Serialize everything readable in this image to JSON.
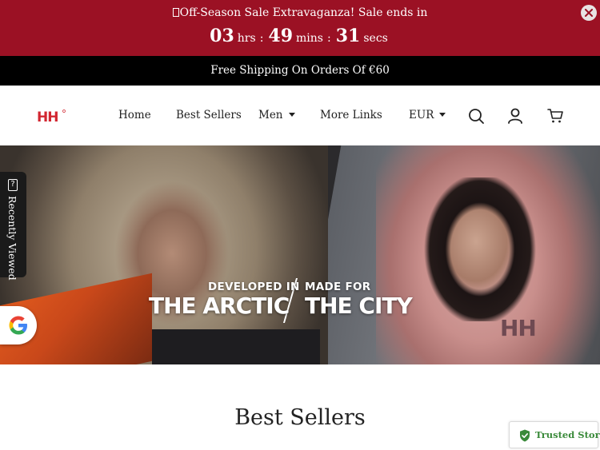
{
  "promo": {
    "message": "Off-Season Sale Extravaganza! Sale ends in",
    "countdown": {
      "hours": "03",
      "hours_unit": "hrs",
      "minutes": "49",
      "minutes_unit": "mins",
      "seconds": "31",
      "seconds_unit": "secs",
      "separator": ":"
    },
    "close_icon": "close-icon",
    "background_color": "#9b1124"
  },
  "shipping": {
    "text": "Free Shipping On Orders Of €60"
  },
  "header": {
    "logo_text": "HH",
    "nav": {
      "home": "Home",
      "best_sellers": "Best Sellers",
      "men": "Men",
      "more_links": "More Links"
    },
    "currency": "EUR",
    "icons": [
      "search-icon",
      "user-icon",
      "cart-icon"
    ],
    "brand_color": "#d22630"
  },
  "hero": {
    "left_small": "DEVELOPED IN",
    "left_big": "THE ARCTIC",
    "right_small": "MADE FOR",
    "right_big": "THE CITY",
    "jacket_logo": "HH"
  },
  "recently_viewed": {
    "label": "Recently Viewed",
    "icon_glyph": "?"
  },
  "google_badge": {
    "icon": "google-icon"
  },
  "best_sellers": {
    "title": "Best Sellers"
  },
  "trusted_store": {
    "label": "Trusted Store",
    "accent_color": "#3a8a3a"
  }
}
